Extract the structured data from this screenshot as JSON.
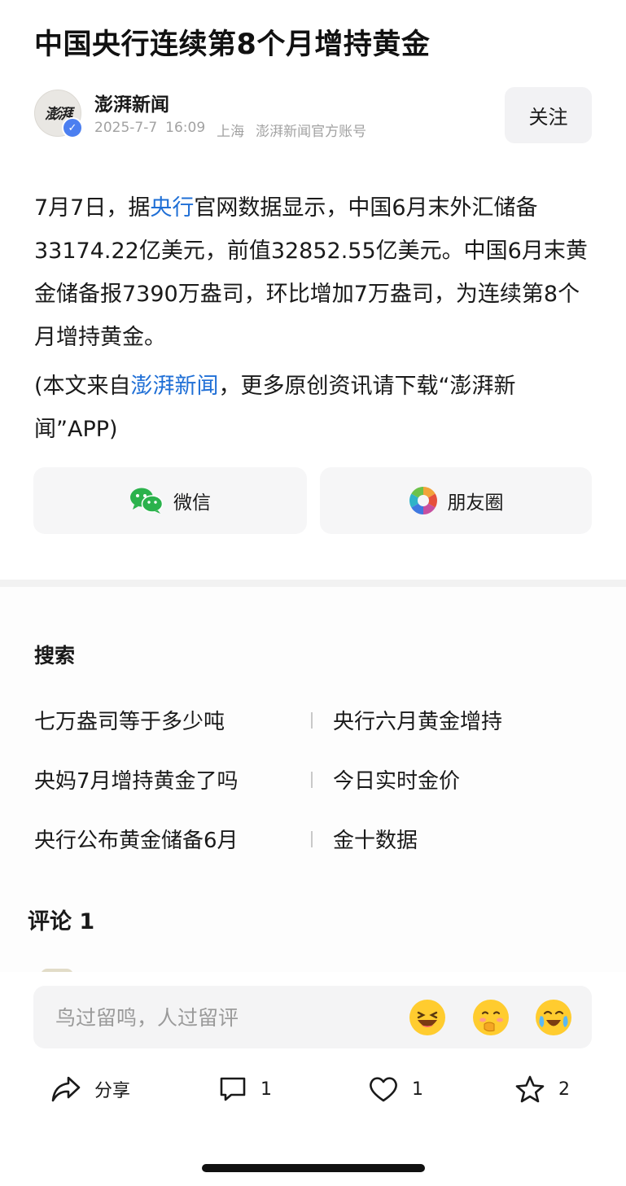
{
  "article": {
    "title": "中国央行连续第8个月增持黄金",
    "author": {
      "name": "澎湃新闻",
      "avatar_text": "澎湃",
      "date": "2025-7-7",
      "time": "16:09",
      "location": "上海",
      "account_type": "澎湃新闻官方账号",
      "follow_label": "关注"
    },
    "body": {
      "p1_before": "7月7日，据",
      "p1_link": "央行",
      "p1_after": "官网数据显示，中国6月末外汇储备33174.22亿美元，前值32852.55亿美元。中国6月末黄金储备报7390万盎司，环比增加7万盎司，为连续第8个月增持黄金。",
      "p2_before": "(本文来自",
      "p2_link": "澎湃新闻",
      "p2_after": "，更多原创资讯请下载“澎湃新闻”APP)"
    },
    "share": {
      "wechat_label": "微信",
      "moments_label": "朋友圈"
    }
  },
  "search": {
    "title": "搜索",
    "items": [
      "七万盎司等于多少吨",
      "央行六月黄金增持",
      "央妈7月增持黄金了吗",
      "今日实时金价",
      "央行公布黄金储备6月",
      "金十数据"
    ]
  },
  "comments": {
    "title": "评论 1",
    "input_placeholder": "鸟过留鸣，人过留评"
  },
  "actions": {
    "share_label": "分享",
    "comment_count": "1",
    "like_count": "1",
    "favorite_count": "2"
  },
  "colors": {
    "link": "#1f6fd6",
    "verified_badge": "#4c7ff0",
    "wechat_green": "#2bb24c"
  }
}
